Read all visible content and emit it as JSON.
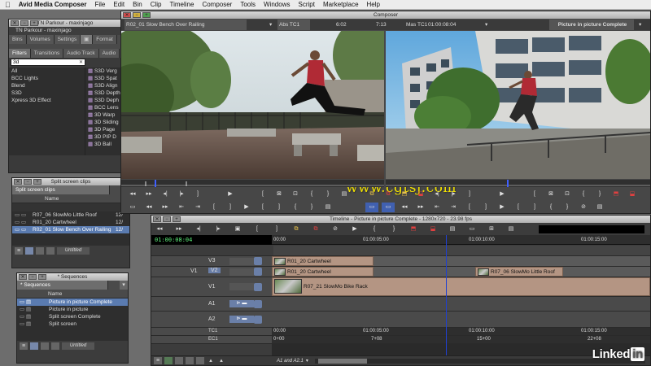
{
  "menubar": {
    "app": "Avid Media Composer",
    "items": [
      "File",
      "Edit",
      "Bin",
      "Clip",
      "Timeline",
      "Composer",
      "Tools",
      "Windows",
      "Script",
      "Marketplace",
      "Help"
    ]
  },
  "project": {
    "title": "TN Parkour - maxinjago",
    "user": "TN Parkour - maxinjago",
    "tabs": [
      "Bins",
      "Volumes",
      "Settings",
      "Format"
    ],
    "subtabs": [
      "Filters",
      "Transitions",
      "Audio Track",
      "Audio"
    ],
    "search_value": "3d",
    "categories": [
      "All",
      "BCC Lights",
      "Blend",
      "S3D",
      "Xpress 3D Effect"
    ],
    "effects": [
      "S3D Verg",
      "S3D Spat",
      "S3D Align",
      "S3D Depth",
      "S3D Deph",
      "BCC Lens",
      "3D Warp",
      "3D Sliding",
      "3D Page",
      "3D PIP D",
      "3D Ball"
    ]
  },
  "split_bin": {
    "title": "Split screen clips",
    "tab": "Split screen clips",
    "col_name": "Name",
    "rows": [
      {
        "name": "R07_06 SlowMo Little Roof",
        "val": "12/"
      },
      {
        "name": "R01_20 Cartwheel",
        "val": "12/"
      },
      {
        "name": "R02_01 Slow Bench Over Railing",
        "val": "12/"
      }
    ],
    "footer": "Untitled"
  },
  "seq_bin": {
    "title": "* Sequences",
    "tab": "* Sequences",
    "col_name": "Name",
    "rows": [
      "Picture in picture Complete",
      "Picture in picture",
      "Split screen Complete",
      "Split screen"
    ],
    "footer": "Untitled"
  },
  "composer": {
    "title": "Composer",
    "source_name": "R02_01 Slow Bench Over Railing",
    "source_tc_label": "Abs TC1",
    "source_dur": "6:02",
    "source_pos": "7:13",
    "record_tc_label": "Mas TC1",
    "record_tc": "01:00:08:04",
    "record_name": "Picture in picture Complete"
  },
  "timeline": {
    "title": "Timeline - Picture in picture Complete - 1280x720 - 23.98 fps",
    "timecode": "01:00:08:04",
    "ruler": [
      "00:00",
      "01:00:05:00",
      "01:00:10:00",
      "01:00:15:00"
    ],
    "tracks": [
      "V3",
      "V2",
      "V1",
      "A1",
      "A2",
      "TC1",
      "EC1"
    ],
    "clips": {
      "v3": "R01_20 Cartwheel",
      "v2a": "R01_20 Cartwheel",
      "v2b": "R07_06 SlowMo Little Roof",
      "v1": "R07_21 SlowMo Bike Rack"
    },
    "tc_row": [
      "00:00",
      "01:00:05:00",
      "01:00:10:00",
      "01:00:15:00"
    ],
    "ec_row": [
      "0+00",
      "7+08",
      "15+00",
      "22+08"
    ],
    "footer_tracks": "A1 and A2.1"
  },
  "overlay": {
    "watermark": "www.cgtsj.com",
    "brand": "Linked",
    "brand_in": "in"
  },
  "colors": {
    "clip": "#b49583",
    "selection": "#5a7bb0",
    "playhead": "#2040d0"
  }
}
